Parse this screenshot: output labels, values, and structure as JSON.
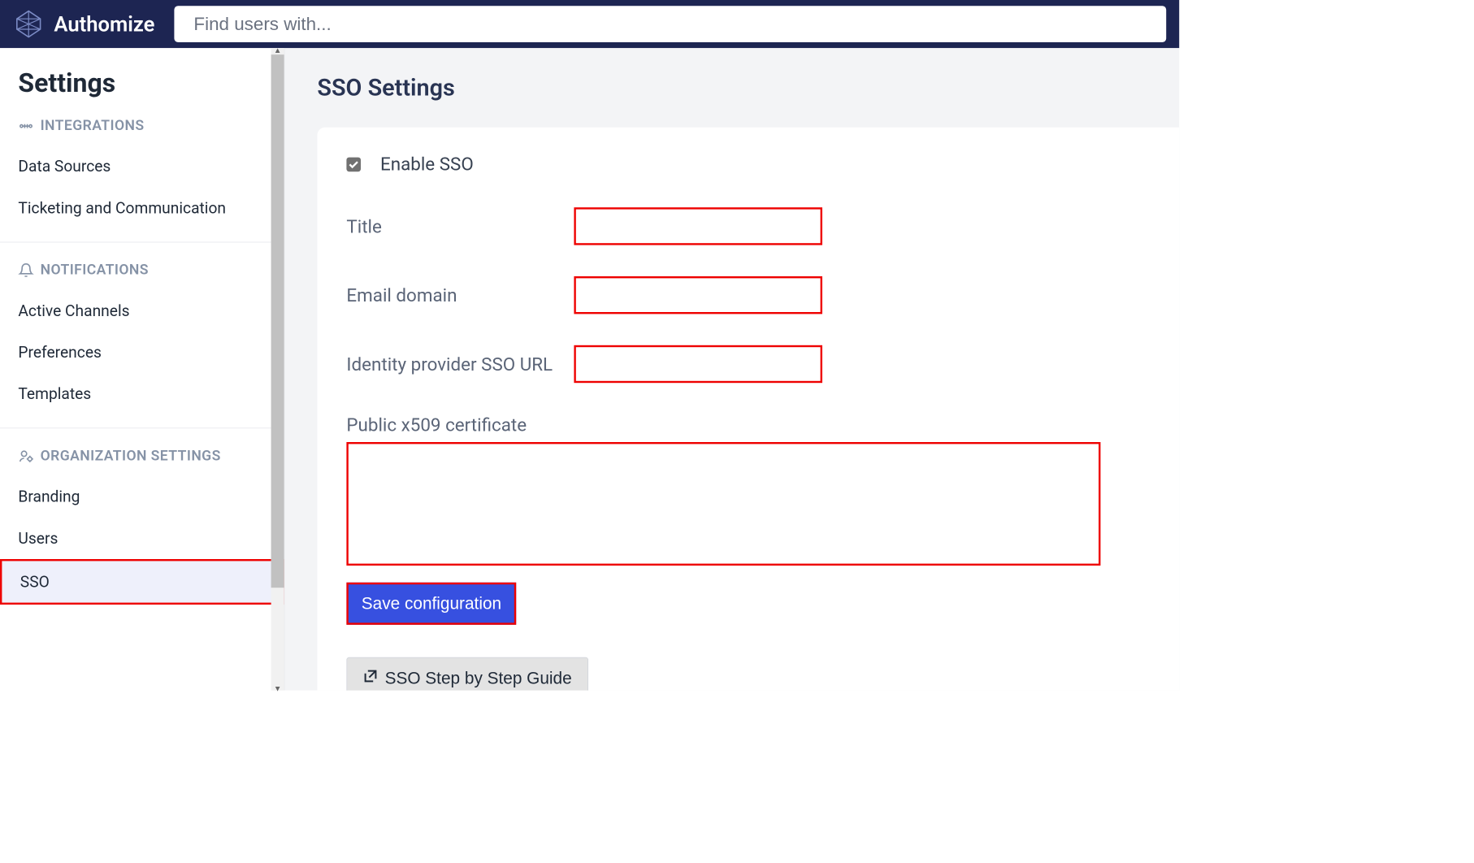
{
  "header": {
    "brand": "Authomize",
    "search_placeholder": "Find users with..."
  },
  "sidebar": {
    "title": "Settings",
    "sections": {
      "integrations": {
        "label": "INTEGRATIONS",
        "items": {
          "data_sources": "Data Sources",
          "ticketing": "Ticketing and Communication"
        }
      },
      "notifications": {
        "label": "NOTIFICATIONS",
        "items": {
          "active_channels": "Active Channels",
          "preferences": "Preferences",
          "templates": "Templates"
        }
      },
      "org_settings": {
        "label": "ORGANIZATION SETTINGS",
        "items": {
          "branding": "Branding",
          "users": "Users",
          "sso": "SSO"
        }
      }
    }
  },
  "main": {
    "heading": "SSO Settings",
    "enable_sso_label": "Enable SSO",
    "enable_sso_checked": true,
    "fields": {
      "title_label": "Title",
      "title_value": "",
      "email_domain_label": "Email domain",
      "email_domain_value": "",
      "idp_url_label": "Identity provider SSO URL",
      "idp_url_value": "",
      "cert_label": "Public x509 certificate",
      "cert_value": ""
    },
    "save_label": "Save configuration",
    "guide_label": "SSO Step by Step Guide"
  }
}
